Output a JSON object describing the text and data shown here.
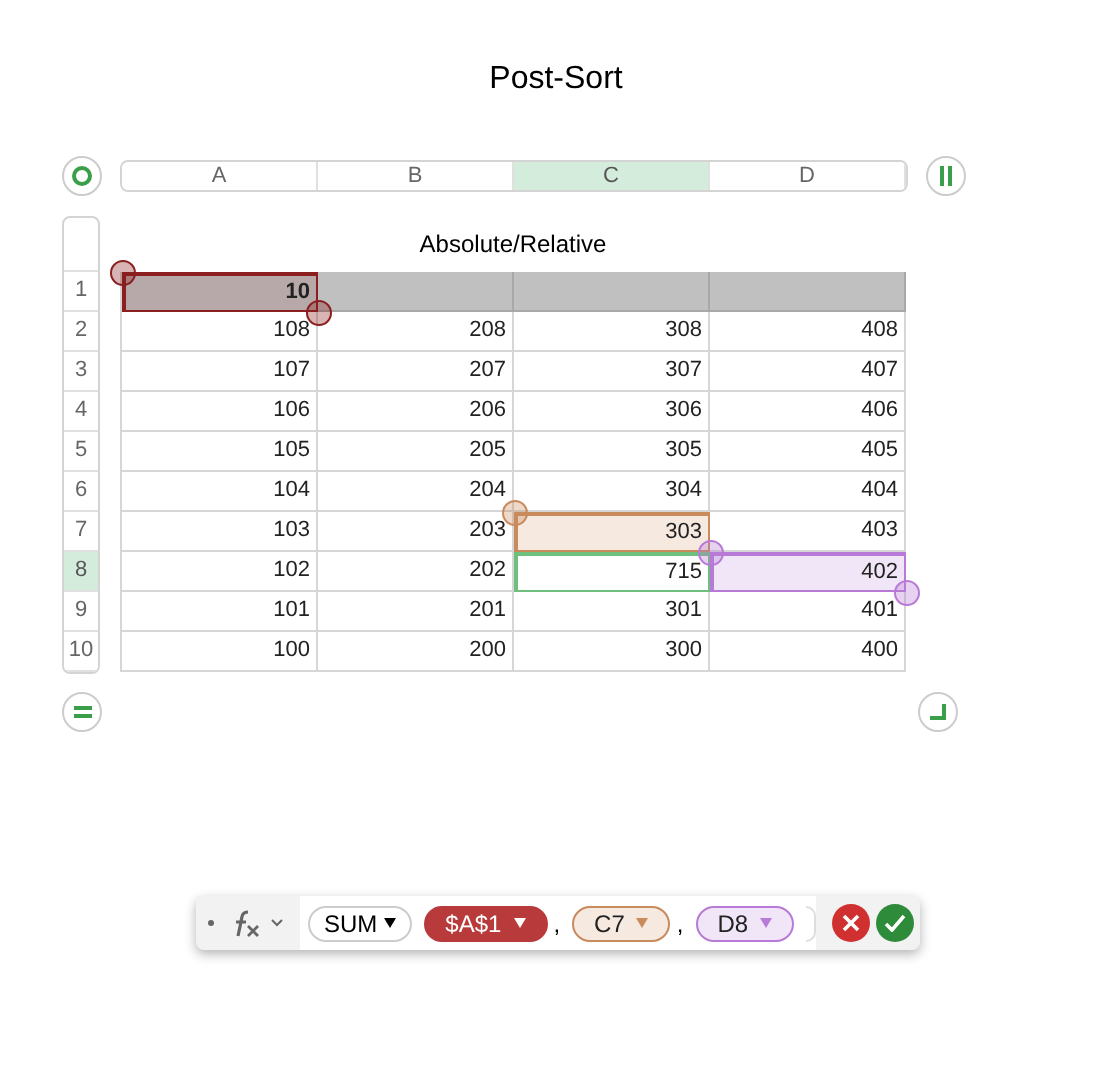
{
  "sheet_title": "Post-Sort",
  "columns": [
    {
      "label": "A",
      "selected": false
    },
    {
      "label": "B",
      "selected": false
    },
    {
      "label": "C",
      "selected": true
    },
    {
      "label": "D",
      "selected": false
    }
  ],
  "table_title": "Absolute/Relative",
  "rows": [
    {
      "label": "1",
      "selected": false,
      "kind": "header",
      "cells": [
        {
          "value": "10",
          "color": "#8b1e1e"
        },
        "",
        "",
        ""
      ]
    },
    {
      "label": "2",
      "selected": false,
      "kind": "body",
      "cells": [
        "108",
        "208",
        "308",
        "408"
      ]
    },
    {
      "label": "3",
      "selected": false,
      "kind": "body",
      "cells": [
        "107",
        "207",
        "307",
        "407"
      ]
    },
    {
      "label": "4",
      "selected": false,
      "kind": "body",
      "cells": [
        "106",
        "206",
        "306",
        "406"
      ]
    },
    {
      "label": "5",
      "selected": false,
      "kind": "body",
      "cells": [
        "105",
        "205",
        "305",
        "405"
      ]
    },
    {
      "label": "6",
      "selected": false,
      "kind": "body",
      "cells": [
        "104",
        "204",
        "304",
        "404"
      ]
    },
    {
      "label": "7",
      "selected": false,
      "kind": "body",
      "cells": [
        "103",
        "203",
        {
          "value": "303",
          "color": "#c98a5c"
        },
        "403"
      ]
    },
    {
      "label": "8",
      "selected": true,
      "kind": "body",
      "cells": [
        "102",
        "202",
        {
          "value": "715",
          "editing": true
        },
        {
          "value": "402",
          "color": "#b77ad6"
        }
      ]
    },
    {
      "label": "9",
      "selected": false,
      "kind": "body",
      "cells": [
        "101",
        "201",
        "301",
        "401"
      ]
    },
    {
      "label": "10",
      "selected": false,
      "kind": "body",
      "cells": [
        "100",
        "200",
        "300",
        "400"
      ]
    }
  ],
  "formula": [
    {
      "kind": "function",
      "text": "SUM"
    },
    {
      "kind": "reference",
      "text": "$A$1",
      "color": "#b83a3a",
      "solid": true
    },
    {
      "kind": "separator",
      "text": ","
    },
    {
      "kind": "reference",
      "text": "C7",
      "color": "#c98a5c",
      "solid": false
    },
    {
      "kind": "separator",
      "text": ","
    },
    {
      "kind": "reference",
      "text": "D8",
      "color": "#b77ad6",
      "solid": false
    }
  ]
}
